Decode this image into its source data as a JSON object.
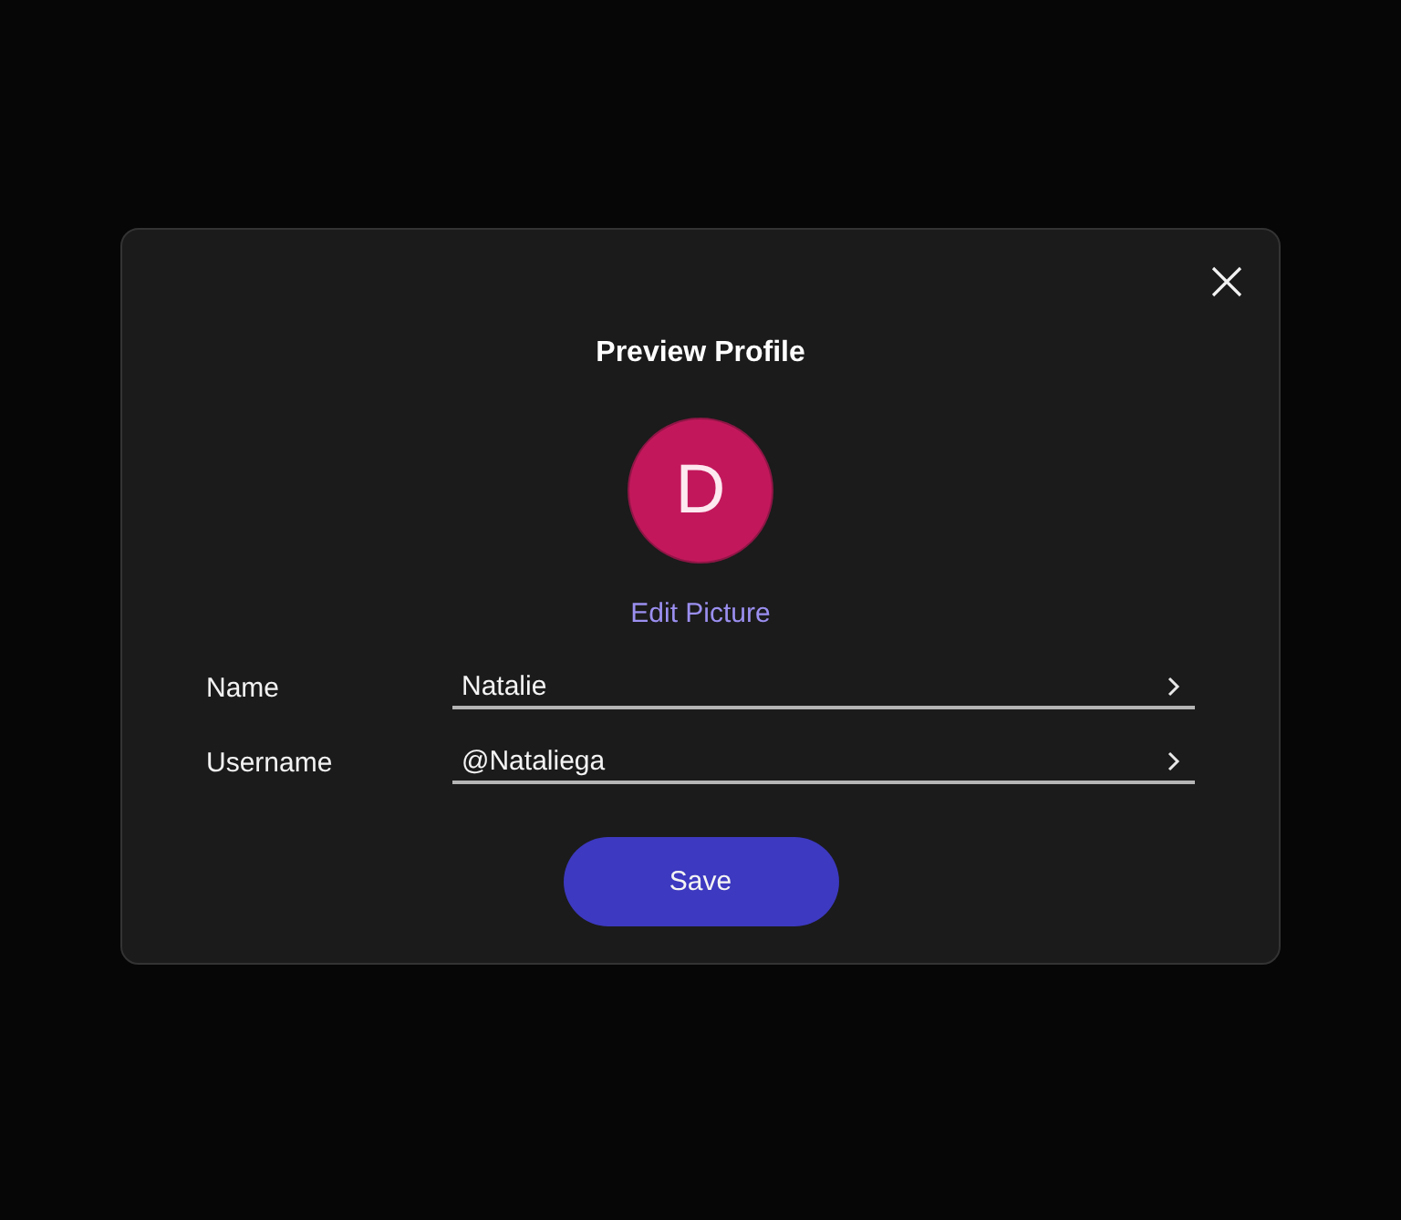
{
  "dialog": {
    "title": "Preview Profile",
    "avatar": {
      "initial": "D"
    },
    "edit_picture": "Edit Picture",
    "fields": [
      {
        "label": "Name",
        "value": "Natalie"
      },
      {
        "label": "Username",
        "value": "@Nataliega"
      }
    ],
    "save_button": "Save"
  }
}
